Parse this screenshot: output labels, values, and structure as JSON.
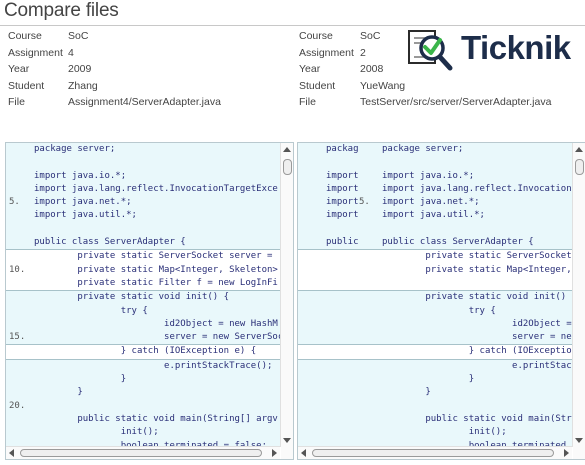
{
  "page": {
    "title": "Compare files"
  },
  "left_meta": [
    {
      "key": "Course",
      "value": "SoC"
    },
    {
      "key": "Assignment",
      "value": "4"
    },
    {
      "key": "Year",
      "value": "2009"
    },
    {
      "key": "Student",
      "value": "Zhang"
    },
    {
      "key": "File",
      "value": "Assignment4/ServerAdapter.java"
    }
  ],
  "right_meta": [
    {
      "key": "Course",
      "value": "SoC"
    },
    {
      "key": "Assignment",
      "value": "2"
    },
    {
      "key": "Year",
      "value": "2008"
    },
    {
      "key": "Student",
      "value": "YueWang"
    },
    {
      "key": "File",
      "value": "TestServer/src/server/ServerAdapter.java"
    }
  ],
  "logo": {
    "text": "Ticknik",
    "icon": "document-check-magnifier-icon"
  },
  "colors": {
    "match_bg": "#e9f8fb",
    "separator": "#a7c2c9",
    "code_text": "#2a2f78",
    "class_name": "#7a3a72"
  },
  "left_code": [
    {
      "num": "",
      "text": "package server;",
      "hl": true,
      "sep": false
    },
    {
      "num": "",
      "text": "",
      "hl": true,
      "sep": false
    },
    {
      "num": "",
      "text": "import java.io.*;",
      "hl": true,
      "sep": false
    },
    {
      "num": "",
      "text": "import java.lang.reflect.InvocationTargetExce",
      "hl": true,
      "sep": false
    },
    {
      "num": "5.",
      "text": "import java.net.*;",
      "hl": true,
      "sep": false
    },
    {
      "num": "",
      "text": "import java.util.*;",
      "hl": true,
      "sep": false
    },
    {
      "num": "",
      "text": "",
      "hl": true,
      "sep": false
    },
    {
      "num": "",
      "text": "public class ServerAdapter {",
      "hl": true,
      "sep": true
    },
    {
      "num": "",
      "text": "        private static ServerSocket server =",
      "hl": false,
      "sep": false
    },
    {
      "num": "10.",
      "text": "        private static Map<Integer, Skeleton>",
      "hl": false,
      "sep": false
    },
    {
      "num": "",
      "text": "        private static Filter f = new LogInFi",
      "hl": false,
      "sep": true
    },
    {
      "num": "",
      "text": "        private static void init() {",
      "hl": true,
      "sep": false
    },
    {
      "num": "",
      "text": "                try {",
      "hl": true,
      "sep": false
    },
    {
      "num": "",
      "text": "                        id2Object = new HashM",
      "hl": true,
      "sep": false
    },
    {
      "num": "15.",
      "text": "                        server = new ServerSoc",
      "hl": true,
      "sep": true
    },
    {
      "num": "",
      "text": "                } catch (IOException e) {",
      "hl": false,
      "sep": true
    },
    {
      "num": "",
      "text": "                        e.printStackTrace();",
      "hl": true,
      "sep": false
    },
    {
      "num": "",
      "text": "                }",
      "hl": true,
      "sep": false
    },
    {
      "num": "",
      "text": "        }",
      "hl": true,
      "sep": false
    },
    {
      "num": "20.",
      "text": "",
      "hl": true,
      "sep": false
    },
    {
      "num": "",
      "text": "        public static void main(String[] argv",
      "hl": true,
      "sep": false
    },
    {
      "num": "",
      "text": "                init();",
      "hl": true,
      "sep": false
    },
    {
      "num": "",
      "text": "                boolean terminated = false;",
      "hl": true,
      "sep": false
    }
  ],
  "right_code": [
    {
      "ref": "packag",
      "num": "",
      "text": "package server;",
      "hl": true,
      "sep": false
    },
    {
      "ref": "",
      "num": "",
      "text": "",
      "hl": true,
      "sep": false
    },
    {
      "ref": "import",
      "num": "",
      "text": "import java.io.*;",
      "hl": true,
      "sep": false
    },
    {
      "ref": "import",
      "num": "",
      "text": "import java.lang.reflect.Invocation",
      "hl": true,
      "sep": false
    },
    {
      "ref": "import",
      "num": "5.",
      "text": "import java.net.*;",
      "hl": true,
      "sep": false
    },
    {
      "ref": "import",
      "num": "",
      "text": "import java.util.*;",
      "hl": true,
      "sep": false
    },
    {
      "ref": "",
      "num": "",
      "text": "",
      "hl": true,
      "sep": false
    },
    {
      "ref": "public",
      "num": "",
      "text": "public class ServerAdapter {",
      "hl": true,
      "sep": true
    },
    {
      "ref": "",
      "num": "",
      "text": "        private static ServerSocket",
      "hl": false,
      "sep": false
    },
    {
      "ref": "",
      "num": "",
      "text": "        private static Map<Integer,",
      "hl": false,
      "sep": false
    },
    {
      "ref": "",
      "num": "",
      "text": "",
      "hl": false,
      "sep": true
    },
    {
      "ref": "",
      "num": "",
      "text": "        private static void init()",
      "hl": true,
      "sep": false
    },
    {
      "ref": "",
      "num": "",
      "text": "                try {",
      "hl": true,
      "sep": false
    },
    {
      "ref": "",
      "num": "",
      "text": "                        id2Object =",
      "hl": true,
      "sep": false
    },
    {
      "ref": "",
      "num": "",
      "text": "                        server = ne",
      "hl": true,
      "sep": true
    },
    {
      "ref": "",
      "num": "",
      "text": "                } catch (IOExceptio",
      "hl": false,
      "sep": true
    },
    {
      "ref": "",
      "num": "",
      "text": "                        e.printStack",
      "hl": true,
      "sep": false
    },
    {
      "ref": "",
      "num": "",
      "text": "                }",
      "hl": true,
      "sep": false
    },
    {
      "ref": "",
      "num": "",
      "text": "        }",
      "hl": true,
      "sep": false
    },
    {
      "ref": "",
      "num": "",
      "text": "",
      "hl": true,
      "sep": false
    },
    {
      "ref": "",
      "num": "",
      "text": "        public static void main(Str",
      "hl": true,
      "sep": false
    },
    {
      "ref": "",
      "num": "",
      "text": "                init();",
      "hl": true,
      "sep": false
    },
    {
      "ref": "",
      "num": "",
      "text": "                boolean terminated",
      "hl": true,
      "sep": false
    }
  ]
}
